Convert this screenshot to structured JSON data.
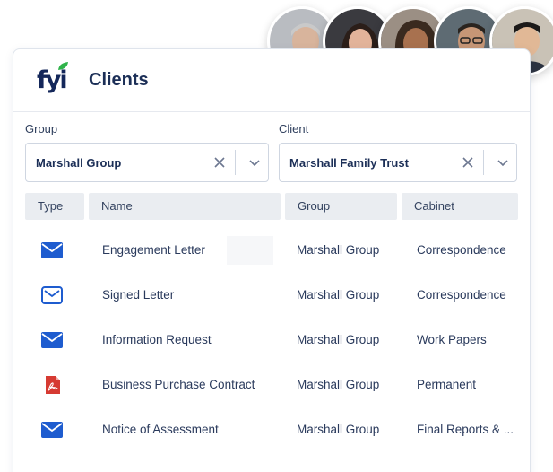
{
  "colors": {
    "accent": "#1e5ccf",
    "brand_navy": "#14275a",
    "brand_green": "#2fb34a",
    "pdf_red": "#d63a32",
    "header_bg": "#eaedf1"
  },
  "app": {
    "logo_text": "fyi",
    "title": "Clients"
  },
  "avatars": [
    {
      "name": "avatar-1",
      "bg": "#b9bcc1",
      "skin": "#d8b49c",
      "hair": "#c9c9c9",
      "shirt": "#6b7078"
    },
    {
      "name": "avatar-2",
      "bg": "#3a3a3f",
      "skin": "#e2b39a",
      "hair": "#2b1e19",
      "shirt": "#ffffff"
    },
    {
      "name": "avatar-3",
      "bg": "#9b8f84",
      "skin": "#a8714f",
      "hair": "#3a2a1f",
      "shirt": "#c88a3c"
    },
    {
      "name": "avatar-4",
      "bg": "#5e6b73",
      "skin": "#c69676",
      "hair": "#2a241f",
      "shirt": "#35649b"
    },
    {
      "name": "avatar-5",
      "bg": "#c9c2b6",
      "skin": "#e1b896",
      "hair": "#1c1a19",
      "shirt": "#2c3340"
    }
  ],
  "filters": {
    "group": {
      "label": "Group",
      "value": "Marshall Group"
    },
    "client": {
      "label": "Client",
      "value": "Marshall Family Trust"
    }
  },
  "table": {
    "headers": [
      "Type",
      "Name",
      "Group",
      "Cabinet"
    ],
    "rows": [
      {
        "type": "mail-filled-icon",
        "name": "Engagement Letter",
        "group": "Marshall Group",
        "cabinet": "Correspondence"
      },
      {
        "type": "mail-outline-icon",
        "name": "Signed Letter",
        "group": "Marshall Group",
        "cabinet": "Correspondence"
      },
      {
        "type": "mail-filled-icon",
        "name": "Information Request",
        "group": "Marshall Group",
        "cabinet": "Work Papers"
      },
      {
        "type": "pdf-icon",
        "name": "Business Purchase Contract",
        "group": "Marshall Group",
        "cabinet": "Permanent"
      },
      {
        "type": "mail-filled-icon",
        "name": "Notice of Assessment",
        "group": "Marshall Group",
        "cabinet": "Final Reports & ..."
      }
    ]
  }
}
